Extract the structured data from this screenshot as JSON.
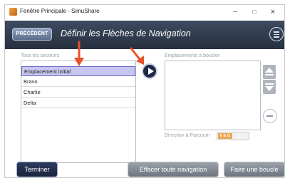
{
  "window": {
    "title": "Fenêtre Principale - SimuShare",
    "icon": "app-icon",
    "controls": [
      "minimize-icon",
      "maximize-icon",
      "close-icon"
    ]
  },
  "header": {
    "back_label": "PRÉCÉDENT",
    "title": "Définir les Flèches de Navigation",
    "menu_icon": "hamburger-menu-icon"
  },
  "sectors": {
    "label": "Tous les secteurs",
    "items": [
      {
        "label": "Emplacement initial",
        "selected": true
      },
      {
        "label": "Bravo",
        "selected": false
      },
      {
        "label": "Charlie",
        "selected": false
      },
      {
        "label": "Delta",
        "selected": false
      }
    ]
  },
  "locations": {
    "label": "Emplacements à boucler",
    "items": []
  },
  "direction": {
    "label": "Direction à Parcourir",
    "toggle_label": "0 & G"
  },
  "footer": {
    "finish_label": "Terminer",
    "clear_label": "Effacer toute navigation",
    "loop_label": "Faire une boucle"
  },
  "colors": {
    "header_bg": "#2b3445",
    "selected_row": "#c7c6ee",
    "annotation_arrow": "#e8512a",
    "toggle_accent": "#f0a44e"
  }
}
